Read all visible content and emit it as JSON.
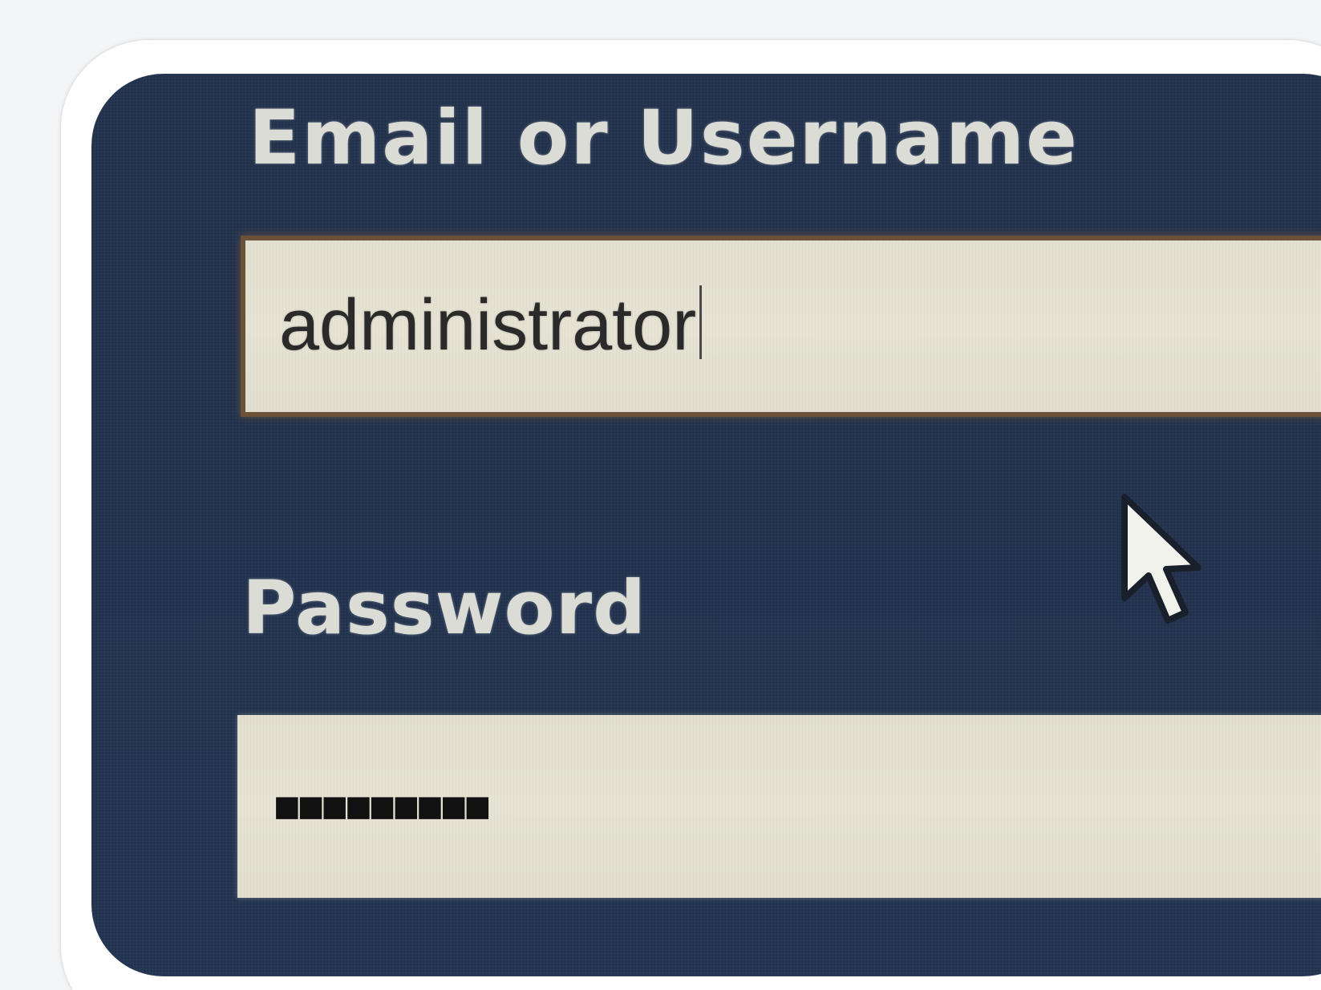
{
  "login_form": {
    "username_label": "Email or Username",
    "username_value": "administrator",
    "password_label": "Password",
    "password_mask": "■■■■■■■■■"
  },
  "icons": {
    "pointer": "mouse-pointer-icon"
  },
  "colors": {
    "panel_background": "#22324d",
    "label_text": "#dcdcd6",
    "field_background": "#e4e1d2",
    "focused_field_border": "#6a5138",
    "input_text": "#2a2a2a"
  }
}
